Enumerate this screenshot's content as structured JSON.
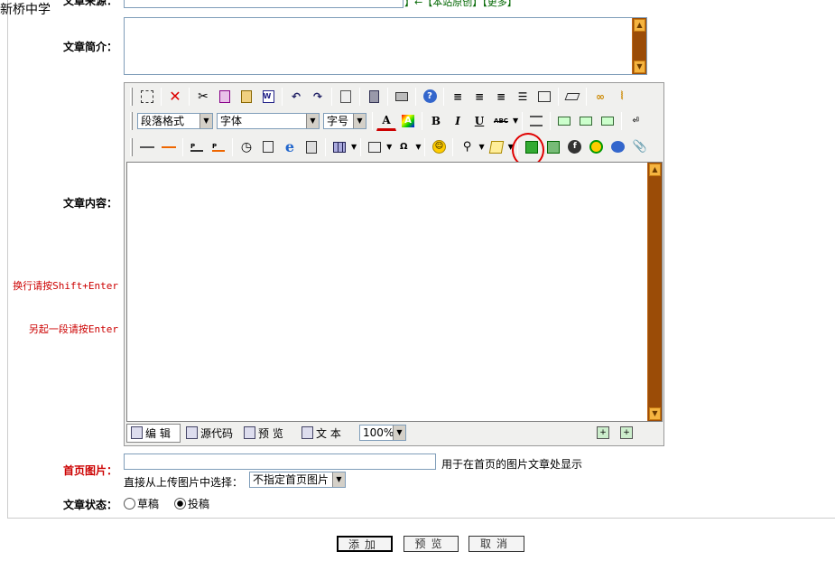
{
  "school_name": "新桥中学",
  "source_row": {
    "label": "文章来源：",
    "links": "本站原创】【更多】",
    "prefix": "】←【"
  },
  "summary": {
    "label": "文章简介："
  },
  "content": {
    "label": "文章内容：",
    "hint1": "换行请按Shift+Enter",
    "hint2": "另起一段请按Enter"
  },
  "toolbar": {
    "paragraph_format": "段落格式",
    "font_family": "字体",
    "font_size": "字号",
    "bold": "B",
    "italic": "I",
    "underline": "U",
    "abc": "ABC"
  },
  "modes": {
    "edit": "编 辑",
    "source": "源代码",
    "preview": "预 览",
    "text": "文 本",
    "zoom": "100%"
  },
  "cover_image": {
    "label": "首页图片：",
    "hint": "用于在首页的图片文章处显示",
    "select_label": "直接从上传图片中选择：",
    "select_value": "不指定首页图片"
  },
  "status": {
    "label": "文章状态：",
    "draft": "草稿",
    "submit": "投稿",
    "selected": "submit"
  },
  "buttons": {
    "add": "添加",
    "preview": "预览",
    "cancel": "取消"
  },
  "colors": {
    "scrollbar": "#9b4c07",
    "scroll_button": "#f5b440",
    "highlight_circle": "#e00000",
    "label_red": "#cc0000"
  }
}
